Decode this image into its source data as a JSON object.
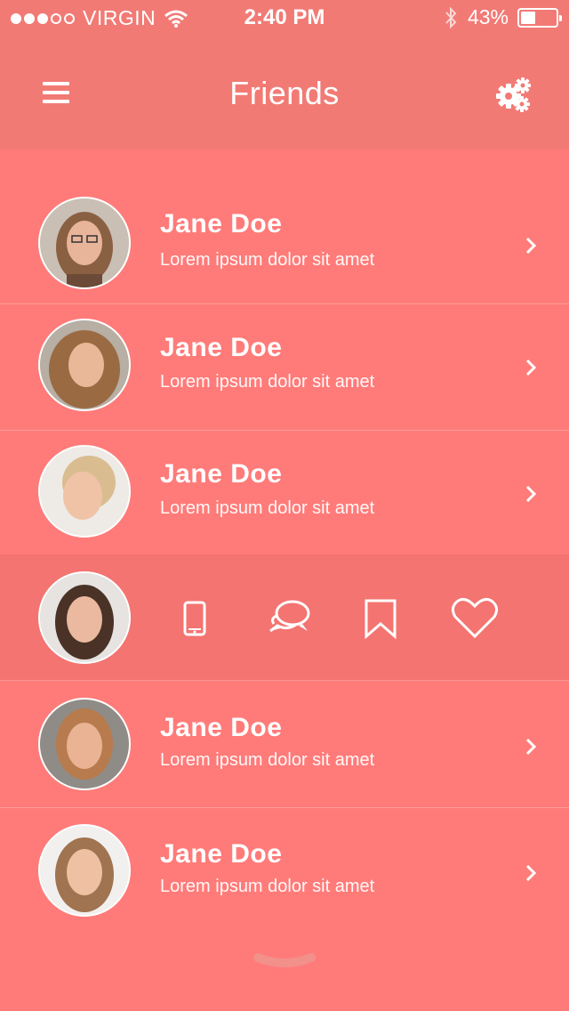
{
  "status_bar": {
    "carrier": "VIRGIN",
    "signal_bars_filled": 3,
    "signal_bars_total": 5,
    "time": "2:40 PM",
    "battery_percent": "43%",
    "battery_level": 0.43
  },
  "header": {
    "title": "Friends",
    "menu_icon": "hamburger-menu-icon",
    "settings_icon": "gears-icon"
  },
  "friends": [
    {
      "name": "Jane Doe",
      "subtitle": "Lorem ipsum dolor sit amet"
    },
    {
      "name": "Jane Doe",
      "subtitle": "Lorem ipsum dolor sit amet"
    },
    {
      "name": "Jane Doe",
      "subtitle": "Lorem ipsum dolor sit amet"
    },
    {
      "actions": [
        "phone-icon",
        "chat-bubbles-icon",
        "bookmark-icon",
        "heart-icon"
      ]
    },
    {
      "name": "Jane Doe",
      "subtitle": "Lorem ipsum dolor sit amet"
    },
    {
      "name": "Jane Doe",
      "subtitle": "Lorem ipsum dolor sit amet"
    }
  ],
  "colors": {
    "background": "#ff7b79",
    "header": "#f27a75",
    "active_row": "#f37471",
    "text": "#ffffff"
  }
}
